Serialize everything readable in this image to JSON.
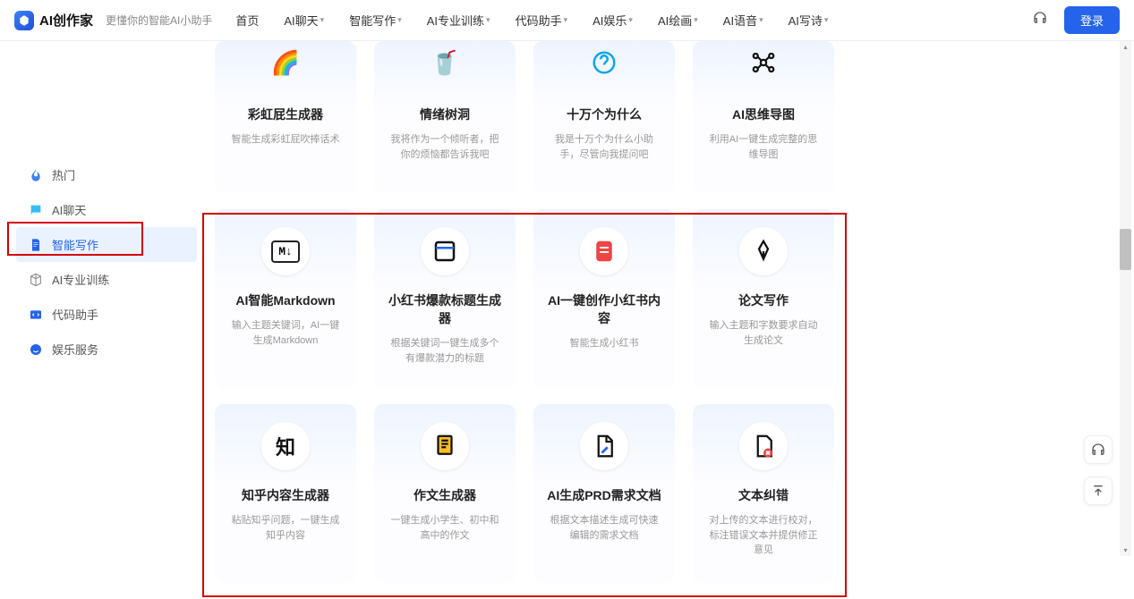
{
  "header": {
    "logo": "AI创作家",
    "tagline": "更懂你的智能AI小助手",
    "nav": [
      "首页",
      "AI聊天",
      "智能写作",
      "AI专业训练",
      "代码助手",
      "AI娱乐",
      "AI绘画",
      "AI语音",
      "AI写诗"
    ],
    "nav_has_dropdown": [
      false,
      true,
      true,
      true,
      true,
      true,
      true,
      true,
      true
    ],
    "login": "登录"
  },
  "sidebar": {
    "items": [
      {
        "label": "热门",
        "icon": "flame",
        "color": "#3b82f6"
      },
      {
        "label": "AI聊天",
        "icon": "chat",
        "color": "#38bdf8"
      },
      {
        "label": "智能写作",
        "icon": "doc",
        "color": "#2563eb",
        "active": true
      },
      {
        "label": "AI专业训练",
        "icon": "cube",
        "color": "#888"
      },
      {
        "label": "代码助手",
        "icon": "code",
        "color": "#2563eb"
      },
      {
        "label": "娱乐服务",
        "icon": "smile",
        "color": "#2563eb"
      }
    ]
  },
  "rows": [
    [
      {
        "title": "彩虹屁生成器",
        "desc": "智能生成彩虹屁吹捧话术",
        "icon": "rainbow"
      },
      {
        "title": "情绪树洞",
        "desc": "我将作为一个倾听者，把你的烦恼都告诉我吧",
        "icon": "cup"
      },
      {
        "title": "十万个为什么",
        "desc": "我是十万个为什么小助手，尽管向我提问吧",
        "icon": "question"
      },
      {
        "title": "AI思维导图",
        "desc": "利用AI一键生成完整的思维导图",
        "icon": "mind"
      }
    ],
    [
      {
        "title": "AI智能Markdown",
        "desc": "输入主题关键词，AI一键生成Markdown",
        "icon": "md"
      },
      {
        "title": "小红书爆款标题生成器",
        "desc": "根据关键词一键生成多个有爆款潜力的标题",
        "icon": "window"
      },
      {
        "title": "AI一键创作小红书内容",
        "desc": "智能生成小红书",
        "icon": "note"
      },
      {
        "title": "论文写作",
        "desc": "输入主题和字数要求自动生成论文",
        "icon": "pen"
      }
    ],
    [
      {
        "title": "知乎内容生成器",
        "desc": "粘贴知乎问题，一键生成知乎内容",
        "icon": "zhi"
      },
      {
        "title": "作文生成器",
        "desc": "一键生成小学生、初中和高中的作文",
        "icon": "essay"
      },
      {
        "title": "AI生成PRD需求文档",
        "desc": "根据文本描述生成可快速编辑的需求文档",
        "icon": "prd"
      },
      {
        "title": "文本纠错",
        "desc": "对上传的文本进行校对，标注错误文本并提供修正意见",
        "icon": "correct"
      }
    ]
  ]
}
